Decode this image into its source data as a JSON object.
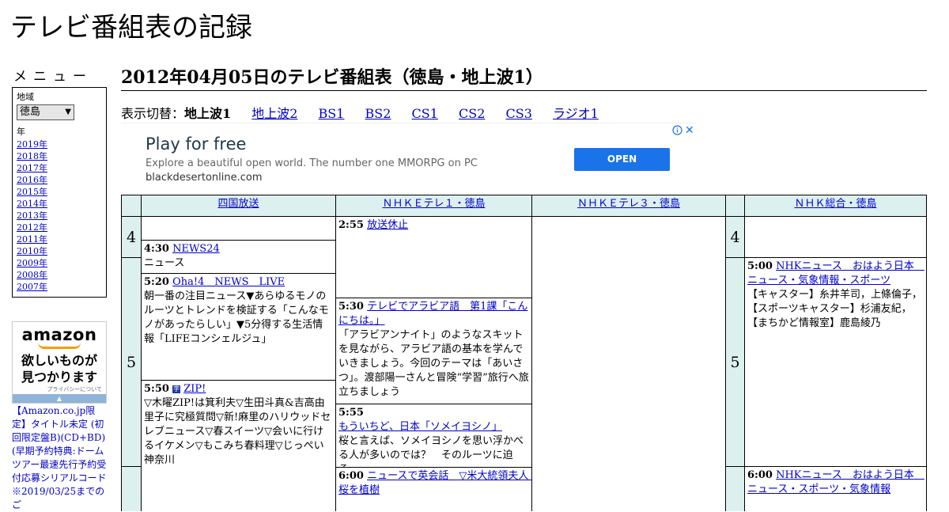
{
  "site": {
    "title": "テレビ番組表の記録"
  },
  "menu": {
    "heading": "メニュー",
    "region_label": "地域",
    "region_value": "徳島",
    "year_label": "年",
    "years": [
      "2019年",
      "2018年",
      "2017年",
      "2016年",
      "2015年",
      "2014年",
      "2013年",
      "2012年",
      "2011年",
      "2010年",
      "2009年",
      "2008年",
      "2007年"
    ]
  },
  "amazon": {
    "logo": "amazon",
    "tagline_1": "欲しいものが",
    "tagline_2": "見つかります",
    "privacy": "プライバシーについて",
    "product": "【Amazon.co.jp限定】タイトル未定 (初回限定盤B)(CD+BD)(早期予約特典:ドームツアー最速先行予約受付応募シリアルコード ※2019/03/25までのご"
  },
  "page": {
    "heading": "2012年04月05日のテレビ番組表（徳島・地上波1）"
  },
  "switcher": {
    "label": "表示切替：",
    "current": "地上波1",
    "links": [
      "地上波2",
      "BS1",
      "BS2",
      "CS1",
      "CS2",
      "CS3",
      "ラジオ1"
    ]
  },
  "ad": {
    "title": "Play for free",
    "description": "Explore a beautiful open world. The number one MMORPG on PC",
    "domain": "blackdesertonline.com",
    "button": "OPEN",
    "info_icon": "info-icon",
    "close_icon": "close-icon"
  },
  "schedule": {
    "channels": [
      "四国放送",
      "ＮＨＫＥテレ１・徳島",
      "ＮＨＫＥテレ３・徳島",
      "ＮＨＫ総合・徳島"
    ],
    "hours": [
      "4",
      "5",
      "4",
      "5"
    ],
    "shikoku": [
      {
        "time": "4:30",
        "title": "NEWS24",
        "desc": "ニュース"
      },
      {
        "time": "5:20",
        "title": "Oha!4　NEWS　LIVE",
        "desc": "朝一番の注目ニュース▼あらゆるモノのルーツとトレンドを検証する「こんなモノがあったらしい」▼5分得する生活情報「LIFEコンシェルジュ」"
      },
      {
        "time": "5:50",
        "title": "ZIP!",
        "icon": "字",
        "desc": "▽木曜ZIP!は箕利夫▽生田斗真&吉高由里子に究極質問▽新!麻里のハリウッドセレブニュース▽春スイーツ▽会いに行けるイケメン▽もこみち春料理▽じっぺい神奈川"
      }
    ],
    "etele1": [
      {
        "time": "2:55",
        "title": "放送休止",
        "desc": ""
      },
      {
        "time": "5:30",
        "title": "テレビでアラビア語　第1課「こんにちは。」",
        "desc": "「アラビアンナイト」のようなスキットを見ながら、アラビア語の基本を学んでいきましょう。今回のテーマは「あいさつ」。渡部陽一さんと冒険“学習”旅行へ旅立ちましょう"
      },
      {
        "time": "5:55",
        "title": "もういちど、日本「ソメイヨシノ」",
        "desc": "桜と言えば、ソメイヨシノを思い浮かべる人が多いのでは？　そのルーツに迫る。"
      },
      {
        "time": "6:00",
        "title": "ニュースで英会話　▽米大統領夫人　桜を植樹",
        "desc": ""
      }
    ],
    "nhk_sogo": [
      {
        "time": "5:00",
        "title": "NHKニュース　おはよう日本　ニュース・気象情報・スポーツ",
        "desc": "【キャスター】糸井羊司，上條倫子，【スポーツキャスター】杉浦友紀，【まちかど情報室】鹿島綾乃"
      },
      {
        "time": "6:00",
        "title": "NHKニュース　おはよう日本　ニュース・スポーツ・気象情報",
        "desc": ""
      }
    ]
  }
}
